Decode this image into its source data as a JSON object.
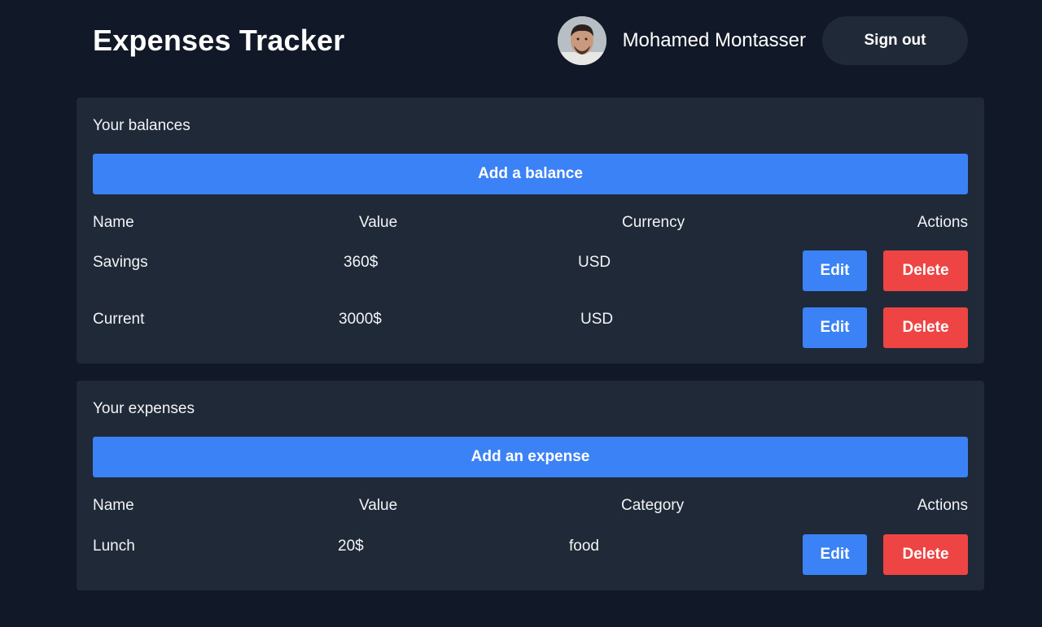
{
  "header": {
    "title": "Expenses Tracker",
    "user_name": "Mohamed Montasser",
    "signout_label": "Sign out"
  },
  "balances": {
    "title": "Your balances",
    "add_label": "Add a balance",
    "columns": [
      "Name",
      "Value",
      "Currency",
      "Actions"
    ],
    "rows": [
      {
        "name": "Savings",
        "value": "360$",
        "currency": "USD"
      },
      {
        "name": "Current",
        "value": "3000$",
        "currency": "USD"
      }
    ]
  },
  "expenses": {
    "title": "Your expenses",
    "add_label": "Add an expense",
    "columns": [
      "Name",
      "Value",
      "Category",
      "Actions"
    ],
    "rows": [
      {
        "name": "Lunch",
        "value": "20$",
        "category": "food"
      }
    ]
  },
  "actions": {
    "edit_label": "Edit",
    "delete_label": "Delete"
  },
  "colors": {
    "background": "#111827",
    "card": "#1f2937",
    "primary": "#3b82f6",
    "danger": "#ef4444"
  },
  "icons": {
    "avatar": "user-avatar-photo"
  }
}
